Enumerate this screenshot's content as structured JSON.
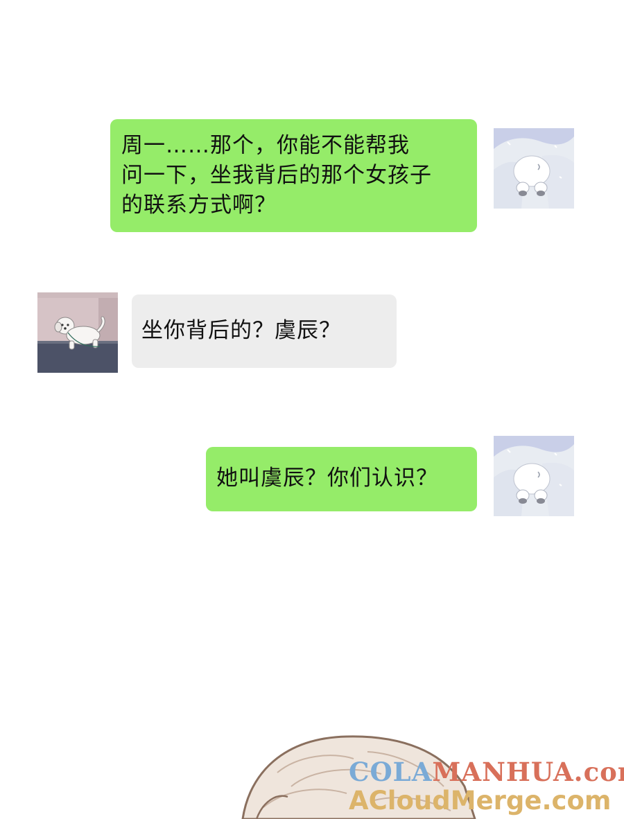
{
  "messages": [
    {
      "side": "right",
      "text": "周一……那个，你能不能帮我\n问一下，坐我背后的那个女孩子\n的联系方式啊？",
      "bubble_color": "#95ec69"
    },
    {
      "side": "left",
      "text": "坐你背后的？虞辰？",
      "bubble_color": "#ededed"
    },
    {
      "side": "right",
      "text": "她叫虞辰？你们认识？",
      "bubble_color": "#95ec69"
    }
  ],
  "avatars": {
    "self": "polar-bear-in-snow-avatar",
    "other": "white-puppy-running-avatar"
  },
  "watermark": {
    "line1_part1": "COLA",
    "line1_part2": "MANHUA.com",
    "line2": "ACloudMerge.com"
  },
  "colors": {
    "green_bubble": "#95ec69",
    "gray_bubble": "#ededed",
    "background": "#ffffff"
  }
}
